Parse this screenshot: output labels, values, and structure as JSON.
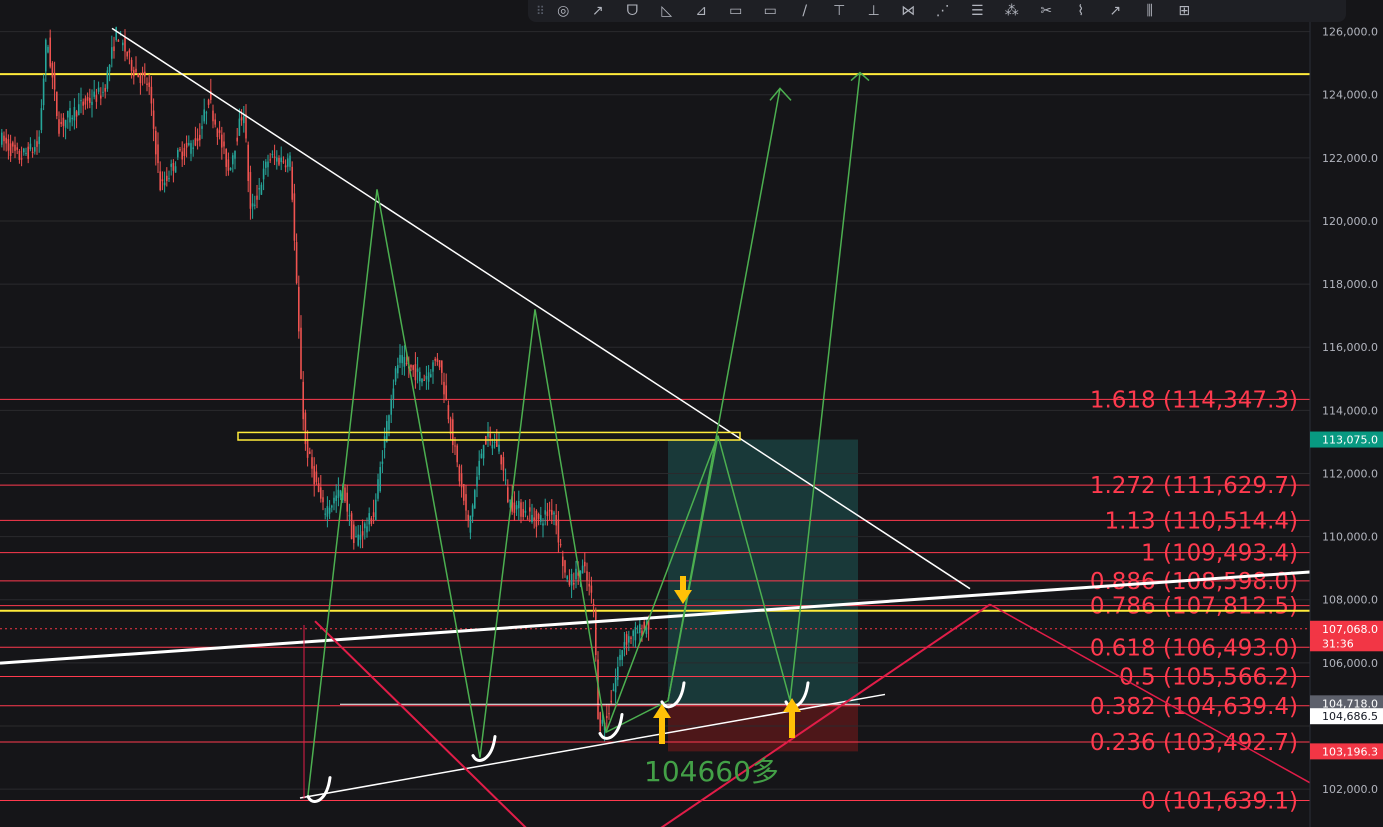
{
  "chart_data": {
    "type": "candlestick",
    "ylim": [
      100800,
      127000
    ],
    "y_ticks": [
      "126,000.0",
      "124,000.0",
      "122,000.0",
      "120,000.0",
      "118,000.0",
      "116,000.0",
      "114,000.0",
      "112,000.0",
      "110,000.0",
      "108,000.0",
      "106,000.0",
      "102,000.0"
    ],
    "y_tick_values": [
      126000,
      124000,
      122000,
      120000,
      118000,
      116000,
      114000,
      112000,
      110000,
      108000,
      106000,
      102000
    ],
    "fib_levels": [
      {
        "label": "1.618 (114,347.3)",
        "value": 114347.3
      },
      {
        "label": "1.272 (111,629.7)",
        "value": 111629.7
      },
      {
        "label": "1.13 (110,514.4)",
        "value": 110514.4
      },
      {
        "label": "1 (109,493.4)",
        "value": 109493.4
      },
      {
        "label": "0.886 (108,598.0)",
        "value": 108598.0
      },
      {
        "label": "0.786 (107,812.5)",
        "value": 107812.5
      },
      {
        "label": "0.618 (106,493.0)",
        "value": 106493.0
      },
      {
        "label": "0.5 (105,566.2)",
        "value": 105566.2
      },
      {
        "label": "0.382 (104,639.4)",
        "value": 104639.4
      },
      {
        "label": "0.236 (103,492.7)",
        "value": 103492.7
      },
      {
        "label": "0 (101,639.1)",
        "value": 101639.1
      }
    ],
    "horizontal_levels": [
      124650,
      107650
    ],
    "price_tags": [
      {
        "label": "113,075.0",
        "value": 113075,
        "bg": "#089981",
        "fg": "#ffffff"
      },
      {
        "label": "107,068.0",
        "value": 107080,
        "bg": "#f23645",
        "fg": "#ffffff"
      },
      {
        "label": "31:36",
        "value": 106620,
        "bg": "#f23645",
        "fg": "#ffffff"
      },
      {
        "label": "104,718.0",
        "value": 104718,
        "bg": "#5d606b",
        "fg": "#ffffff"
      },
      {
        "label": "104,686.5",
        "value": 104310,
        "bg": "#ffffff",
        "fg": "#131722"
      },
      {
        "label": "103,196.3",
        "value": 103196,
        "bg": "#f23645",
        "fg": "#ffffff"
      }
    ],
    "annotation": "104660多"
  },
  "toolbar": {
    "grip": "⠿",
    "icons": [
      "◎",
      "↗",
      "ᗜ",
      "◺",
      "⊿",
      "▭",
      "▭",
      "/",
      "⊤",
      "⊥",
      "⋈",
      "⋰",
      "☰",
      "⁂",
      "✂",
      "⌇",
      "↗",
      "⫼",
      "⊞"
    ]
  },
  "colors": {
    "background": "#151518",
    "grid": "#2a2a2d",
    "fib": "#ff3a4e",
    "yellow": "#ffeb3b",
    "green_path": "#4caf50",
    "white_line": "#ffffff",
    "red_channel": "#e11d48",
    "candle_up": "#26a69a",
    "candle_down": "#ef5350"
  }
}
